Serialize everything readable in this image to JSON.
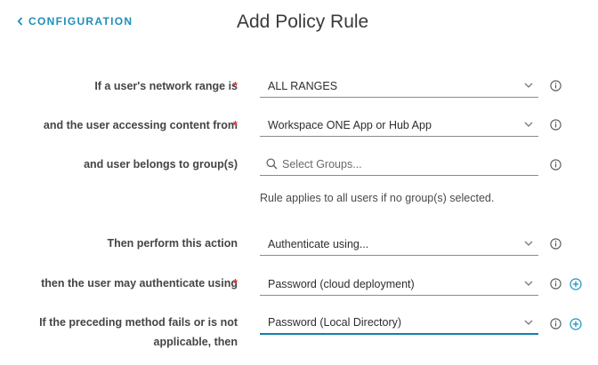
{
  "header": {
    "back_label": "CONFIGURATION",
    "title": "Add Policy Rule"
  },
  "colors": {
    "accent": "#1f8fb8",
    "required": "#d93d3d",
    "focus": "#0f7fb1"
  },
  "form": {
    "network_range": {
      "label": "If a user's network range is",
      "required": "*",
      "value": "ALL RANGES"
    },
    "device_type": {
      "label": "and the user accessing content from",
      "required": "*",
      "value": "Workspace ONE App or Hub App"
    },
    "groups": {
      "label": "and user belongs to group(s)",
      "placeholder": "Select Groups...",
      "helper": "Rule applies to all users if no group(s) selected."
    },
    "action": {
      "label": "Then perform this action",
      "value": "Authenticate using..."
    },
    "auth_method": {
      "label": "then the user may authenticate using",
      "required": "*",
      "value": "Password (cloud deployment)"
    },
    "fallback": {
      "label": "If the preceding method fails or is not applicable, then",
      "value": "Password (Local Directory)"
    }
  },
  "icons": {
    "back": "chevron-left-icon",
    "dropdown": "chevron-down-icon",
    "info": "info-icon",
    "add": "plus-circle-icon",
    "search": "search-icon"
  }
}
